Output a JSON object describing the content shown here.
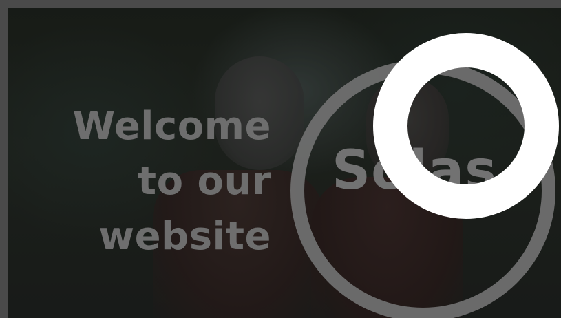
{
  "hero": {
    "welcome_lines": [
      "Welcome",
      "to our",
      "website"
    ],
    "brand": "Solas"
  },
  "ui": {
    "overlay_icon": "loading-ring-icon"
  },
  "colors": {
    "frame": "#4a4a4a",
    "text_muted": "#6e6e6e",
    "icon": "#ffffff"
  }
}
